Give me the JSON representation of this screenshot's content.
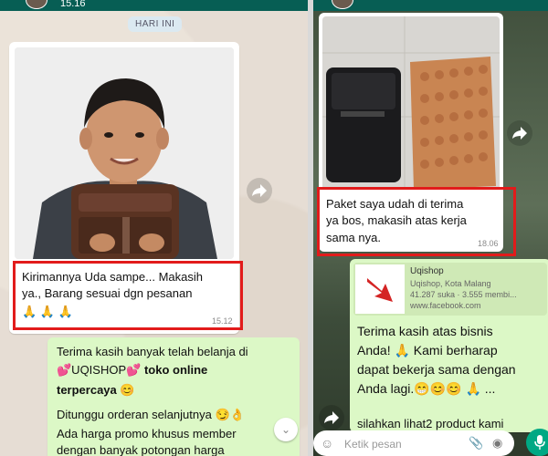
{
  "left_chat": {
    "status_time": "15.16",
    "date_divider": "HARI INI",
    "customer_message": {
      "text_line1": "Kirimannya Uda sampe... Makasih",
      "text_line2": "ya., Barang sesuai dgn pesanan",
      "emoji": "🙏 🙏 🙏",
      "time": "15.12"
    },
    "shop_reply": {
      "line1": "Terima kasih banyak telah belanja di",
      "line2_prefix": "💕UQISHOP💕",
      "line2_bold": "toko online",
      "line3_bold": "terpercaya",
      "line3_emoji": "😊",
      "line4": "Ditunggu orderan selanjutnya 😏👌",
      "line5": "Ada harga promo khusus member",
      "line6": "dengan banyak potongan harga"
    }
  },
  "right_chat": {
    "customer_message": {
      "text_line1": "Paket saya udah di terima",
      "text_line2": "ya bos, makasih atas kerja",
      "text_line3": "sama nya.",
      "time": "18.06"
    },
    "link_preview": {
      "title": "Uqishop",
      "line1": "Uqishop, Kota Malang",
      "line2": "41.287 suka · 3.555 membi...",
      "url": "www.facebook.com"
    },
    "shop_reply": {
      "line1": "Terima kasih atas bisnis",
      "line2": "Anda! 🙏 Kami berharap",
      "line3": "dapat bekerja sama dengan",
      "line4": "Anda lagi.😁😊😊 🙏 ...",
      "line5": "silahkan lihat2 product kami"
    },
    "input_placeholder": "Ketik pesan"
  },
  "colors": {
    "incoming_bubble": "#ffffff",
    "outgoing_bubble": "#dcf8c6",
    "highlight_box": "#e21b1b",
    "whatsapp_green": "#00a884"
  }
}
